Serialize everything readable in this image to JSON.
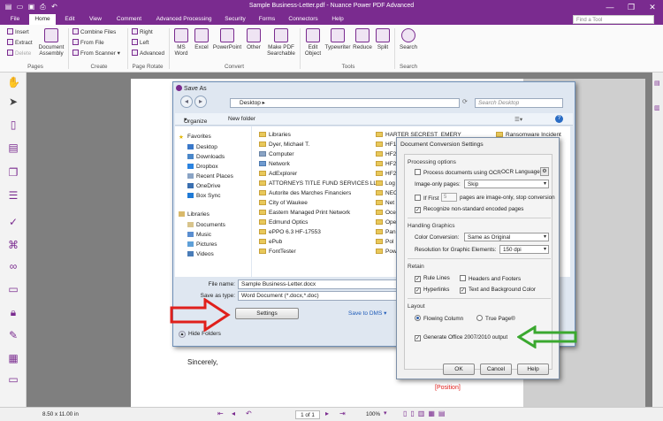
{
  "app": {
    "title": "Sample Business-Letter.pdf - Nuance Power PDF Advanced",
    "brand_color": "#7a2b8f",
    "quick_access": [
      "file-icon",
      "open-icon",
      "save-icon",
      "print-icon",
      "undo-icon"
    ]
  },
  "tabs": [
    "File",
    "Home",
    "Edit",
    "View",
    "Comment",
    "Advanced Processing",
    "Security",
    "Forms",
    "Connectors",
    "Help"
  ],
  "active_tab": "Home",
  "find_tool_placeholder": "Find a Tool",
  "ribbon": {
    "pages": {
      "group": "Pages",
      "insert": "Insert",
      "extract": "Extract",
      "delete": "Delete",
      "doc_assembly": "Document\nAssembly"
    },
    "create": {
      "group": "Create",
      "combine": "Combine Files",
      "from_file": "From File",
      "from_scanner": "From Scanner"
    },
    "rotate": {
      "group": "Page Rotate",
      "right": "Right",
      "left": "Left",
      "advanced": "Advanced"
    },
    "convert": {
      "group": "Convert",
      "ms_word": "MS\nWord",
      "excel": "Excel",
      "powerpoint": "PowerPoint",
      "other": "Other",
      "make_pdf": "Make PDF\nSearchable"
    },
    "tools": {
      "group": "Tools",
      "edit_object": "Edit\nObject",
      "typewriter": "Typewriter",
      "reduce": "Reduce",
      "split": "Split"
    },
    "search": {
      "group": "Search",
      "label": "Search"
    }
  },
  "document": {
    "sincerely": "Sincerely,",
    "position": "[Position]"
  },
  "statusbar": {
    "page_size": "8.50 x 11.00 in",
    "page_indicator": "1 of 1",
    "zoom": "100%"
  },
  "save_as": {
    "title": "Save As",
    "address": "Desktop",
    "search_placeholder": "Search Desktop",
    "organize": "Organize",
    "new_folder": "New folder",
    "nav": {
      "favorites_header": "Favorites",
      "favorites": [
        "Desktop",
        "Downloads",
        "Dropbox",
        "Recent Places",
        "OneDrive",
        "Box Sync"
      ],
      "libraries_header": "Libraries",
      "libraries": [
        "Documents",
        "Music",
        "Pictures",
        "Videos"
      ]
    },
    "files_col1": [
      "Libraries",
      "Dyer, Michael T.",
      "Computer",
      "Network",
      "AdExplorer",
      "ATTORNEYS TITLE FUND SERVICES LLC",
      "Autorite des Marches Financiers",
      "City of Waukee",
      "Eastern Managed Print Network",
      "Edmund Optics",
      "ePPO 6.3 HF-17553",
      "ePub",
      "FontTester"
    ],
    "files_col2": [
      "HARTER SECREST_EMERY",
      "HF1",
      "HF2",
      "HF2",
      "HF2",
      "Log",
      "NEC",
      "Net",
      "Oce",
      "Ope",
      "Pan",
      "Pol",
      "Pow"
    ],
    "files_col3": [
      "Ransomware Incident"
    ],
    "file_name_label": "File name:",
    "file_name": "Sample Business-Letter.docx",
    "save_type_label": "Save as type:",
    "save_type": "Word Document (*.docx,*.doc)",
    "settings": "Settings",
    "save_to_dms": "Save to DMS",
    "hide_folders": "Hide Folders"
  },
  "dcs": {
    "title": "Document Conversion Settings",
    "processing_header": "Processing options",
    "process_ocr": "Process documents using OCR",
    "ocr_language": "OCR Language:",
    "image_only_label": "Image-only pages:",
    "image_only_value": "Skip",
    "if_first": "If First",
    "if_first_n": "5",
    "pages_stop": "pages are image-only, stop conversion",
    "recognize": "Recognize non-standard encoded pages",
    "graphics_header": "Handling Graphics",
    "color_label": "Color Conversion:",
    "color_value": "Same as Original",
    "resolution_label": "Resolution for Graphic Elements:",
    "resolution_value": "150 dpi",
    "retain_header": "Retain",
    "rule_lines": "Rule Lines",
    "headers_footers": "Headers and Footers",
    "hyperlinks": "Hyperlinks",
    "text_bg": "Text and Background Color",
    "layout_header": "Layout",
    "flowing": "Flowing Column",
    "true_page": "True Page®",
    "generate_office": "Generate Office 2007/2010 output",
    "ok": "OK",
    "cancel": "Cancel",
    "help": "Help"
  },
  "colors": {
    "red_arrow": "#e0201c",
    "green_arrow": "#3aa82f",
    "position_text": "#e0201c"
  }
}
